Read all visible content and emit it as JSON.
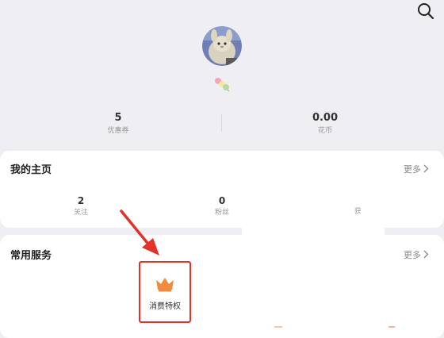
{
  "profile": {
    "coupons": {
      "value": "5",
      "label": "优惠券"
    },
    "flower_coins": {
      "value": "0.00",
      "label": "花币"
    }
  },
  "home": {
    "title": "我的主页",
    "more": "更多",
    "stats": [
      {
        "value": "2",
        "label": "关注"
      },
      {
        "value": "0",
        "label": "粉丝"
      },
      {
        "label": "获"
      }
    ]
  },
  "services": {
    "title": "常用服务",
    "more": "更多",
    "items": [
      {
        "label": "消费特权",
        "icon": "crown-icon"
      }
    ]
  },
  "colors": {
    "highlight_red": "#e4322b",
    "crown_orange": "#f08a3e",
    "background": "#efeff3"
  }
}
